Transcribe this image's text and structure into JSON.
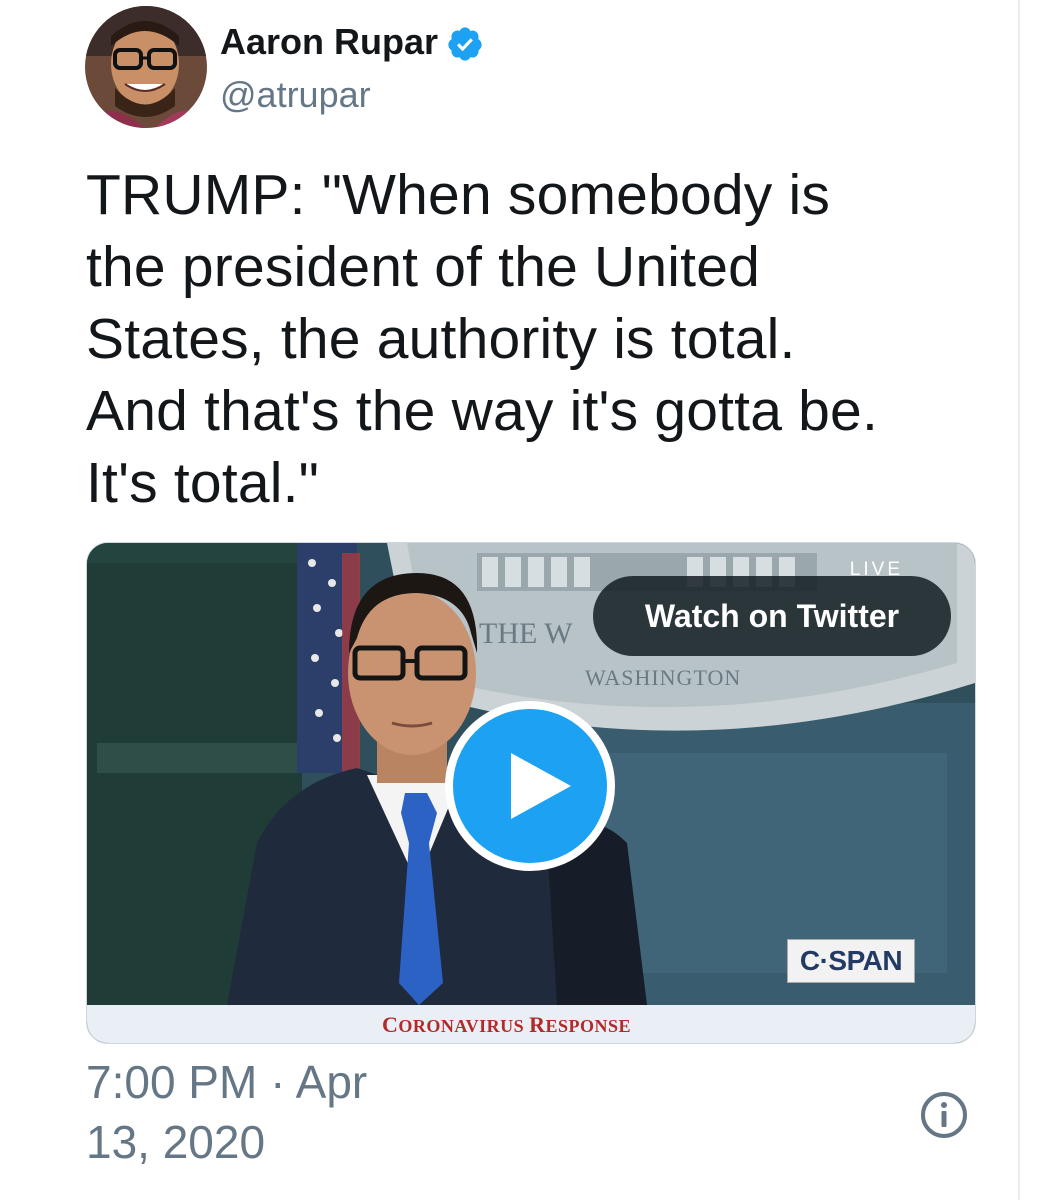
{
  "author": {
    "name": "Aaron Rupar",
    "handle": "@atrupar",
    "verified": true,
    "verified_color": "#1da1f2"
  },
  "tweet": {
    "text": "TRUMP: \"When somebody is\nthe president of the United\nStates, the authority is total.\nAnd that's the way it's gotta be.\nIt's total.\""
  },
  "media": {
    "live_label": "LIVE",
    "watch_label": "Watch on Twitter",
    "play_icon": "play-icon",
    "channel_logo": "C·SPAN",
    "chyron_first": "C",
    "chyron_first_rest": "ORONAVIRUS ",
    "chyron_second": "R",
    "chyron_second_rest": "ESPONSE",
    "backdrop_text_1": "THE W",
    "backdrop_text_2": "WASHINGTON"
  },
  "footer": {
    "timestamp": "7:00 PM · Apr\n13, 2020",
    "info_icon": "info-icon"
  },
  "colors": {
    "text_primary": "#14171a",
    "text_secondary": "#657786",
    "accent": "#1da1f2",
    "chyron_red": "#b22a2a"
  }
}
